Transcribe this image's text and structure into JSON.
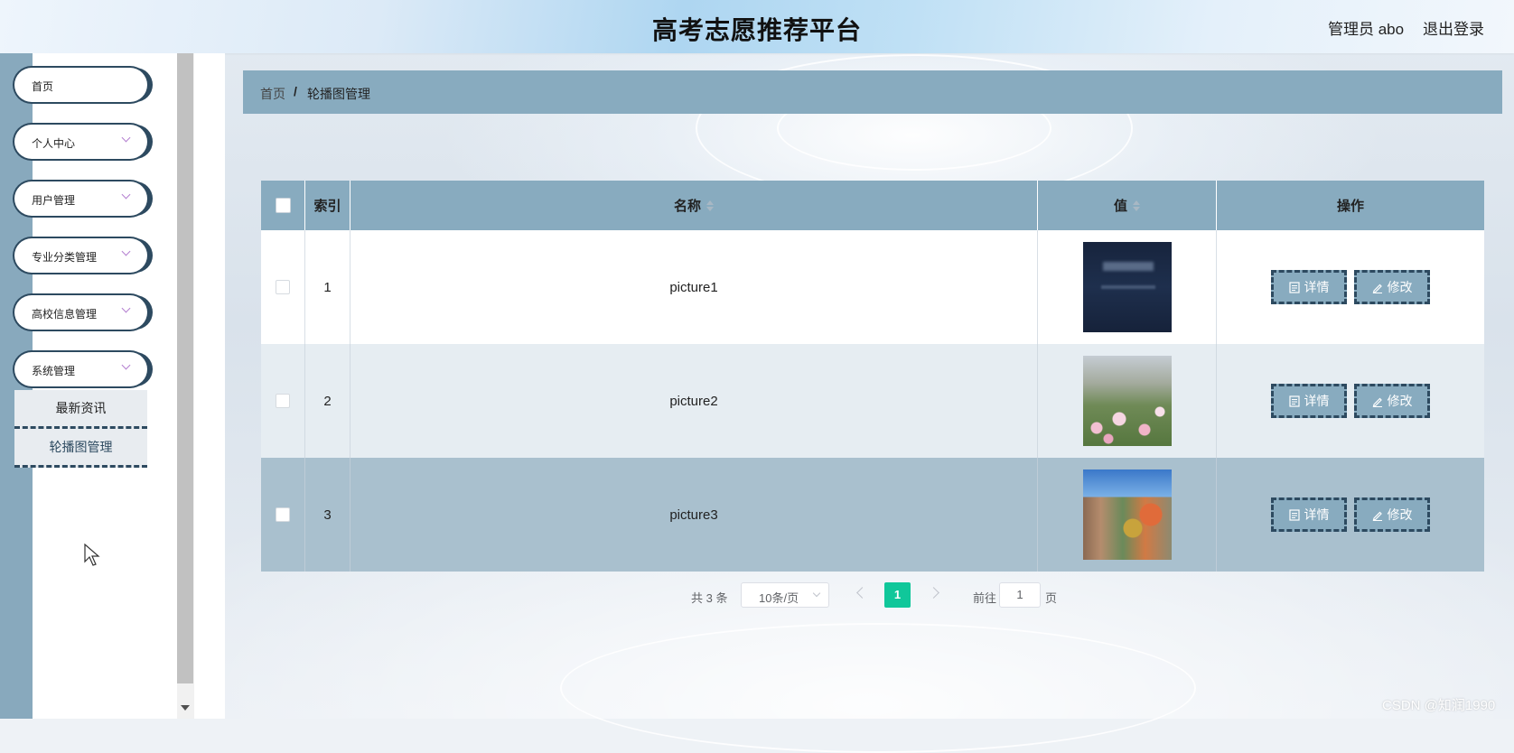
{
  "header": {
    "title": "高考志愿推荐平台",
    "user": "管理员 abo",
    "logout": "退出登录"
  },
  "sidebar": {
    "items": [
      {
        "label": "首页",
        "has_chevron": false
      },
      {
        "label": "个人中心",
        "has_chevron": true
      },
      {
        "label": "用户管理",
        "has_chevron": true
      },
      {
        "label": "专业分类管理",
        "has_chevron": true
      },
      {
        "label": "高校信息管理",
        "has_chevron": true
      },
      {
        "label": "系统管理",
        "has_chevron": true
      }
    ],
    "sub_items": [
      {
        "label": "最新资讯",
        "active": false
      },
      {
        "label": "轮播图管理",
        "active": true
      }
    ]
  },
  "breadcrumb": {
    "home": "首页",
    "separator": "/",
    "current": "轮播图管理"
  },
  "table": {
    "columns": [
      {
        "label": "",
        "sortable": false
      },
      {
        "label": "索引",
        "sortable": false
      },
      {
        "label": "名称",
        "sortable": true
      },
      {
        "label": "值",
        "sortable": true
      },
      {
        "label": "操作",
        "sortable": false
      }
    ],
    "rows": [
      {
        "index": "1",
        "name": "picture1",
        "image": "dark-banner-image"
      },
      {
        "index": "2",
        "name": "picture2",
        "image": "campus-flowers-image"
      },
      {
        "index": "3",
        "name": "picture3",
        "image": "campus-autumn-image"
      }
    ],
    "actions": {
      "detail": "详情",
      "edit": "修改"
    }
  },
  "pagination": {
    "total": "共 3 条",
    "page_size": "10条/页",
    "current_page": "1",
    "goto_label": "前往",
    "goto_value": "1",
    "page_suffix": "页"
  },
  "watermark": "CSDN @知润1990",
  "colors": {
    "accent": "#88abbf",
    "dark": "#2d4a60",
    "page_active": "#10c79a"
  }
}
